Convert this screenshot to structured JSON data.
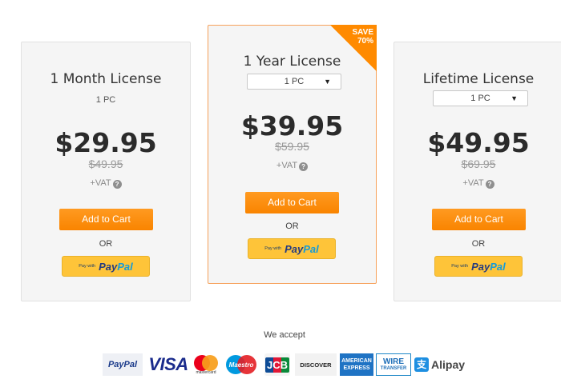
{
  "plans": [
    {
      "title": "1 Month License",
      "pc_label": "1 PC",
      "price": "$29.95",
      "old_price": "$49.95",
      "vat": "+VAT",
      "cart_label": "Add to Cart",
      "or_label": "OR",
      "paypal_small": "Pay with",
      "paypal_a": "Pay",
      "paypal_b": "Pal"
    },
    {
      "title": "1 Year License",
      "pc_label": "1 PC",
      "price": "$39.95",
      "old_price": "$59.95",
      "vat": "+VAT",
      "cart_label": "Add to Cart",
      "or_label": "OR",
      "paypal_small": "Pay with",
      "paypal_a": "Pay",
      "paypal_b": "Pal",
      "badge_line1": "SAVE",
      "badge_line2": "70%"
    },
    {
      "title": "Lifetime License",
      "pc_label": "1 PC",
      "price": "$49.95",
      "old_price": "$69.95",
      "vat": "+VAT",
      "cart_label": "Add to Cart",
      "or_label": "OR",
      "paypal_small": "Pay with",
      "paypal_a": "Pay",
      "paypal_b": "Pal"
    }
  ],
  "footer": {
    "accept_label": "We accept",
    "logos": {
      "paypal": "PayPal",
      "visa": "VISA",
      "mastercard": "mastercard",
      "maestro": "Maestro",
      "jcb": "JCB",
      "discover": "DISCOVER",
      "amex_line1": "AMERICAN",
      "amex_line2": "EXPRESS",
      "wire_line1": "WIRE",
      "wire_line2": "TRANSFER",
      "alipay": "Alipay"
    }
  },
  "colors": {
    "accent": "#f98400",
    "card_bg": "#f5f5f5",
    "paypal_yellow": "#fec439"
  }
}
